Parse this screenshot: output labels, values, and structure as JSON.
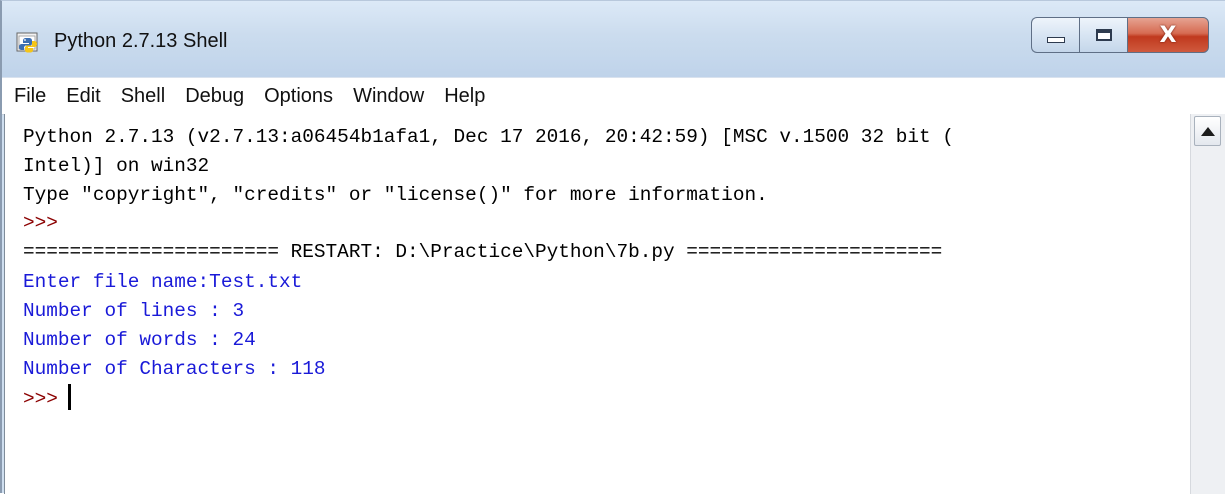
{
  "window": {
    "title": "Python 2.7.13 Shell",
    "close_glyph": "X"
  },
  "menu": [
    "File",
    "Edit",
    "Shell",
    "Debug",
    "Options",
    "Window",
    "Help"
  ],
  "console": {
    "line1": "Python 2.7.13 (v2.7.13:a06454b1afa1, Dec 17 2016, 20:42:59) [MSC v.1500 32 bit (",
    "line2": "Intel)] on win32",
    "line3": "Type \"copyright\", \"credits\" or \"license()\" for more information.",
    "prompt1": ">>>",
    "restart": "====================== RESTART: D:\\Practice\\Python\\7b.py ======================",
    "input_line": "Enter file name:Test.txt",
    "out_lines": "Number of lines : 3",
    "out_words": "Number of words : 24",
    "out_chars": "Number of Characters : 118",
    "prompt2": ">>>"
  },
  "icons": {
    "app": "python-idle-icon",
    "minimize": "minimize-icon",
    "maximize": "maximize-icon",
    "close": "close-icon",
    "scroll_up": "scroll-up-arrow-icon"
  },
  "colors": {
    "output_blue": "#1a1ad8",
    "prompt_red": "#8b0000",
    "close_red": "#c0391e"
  }
}
